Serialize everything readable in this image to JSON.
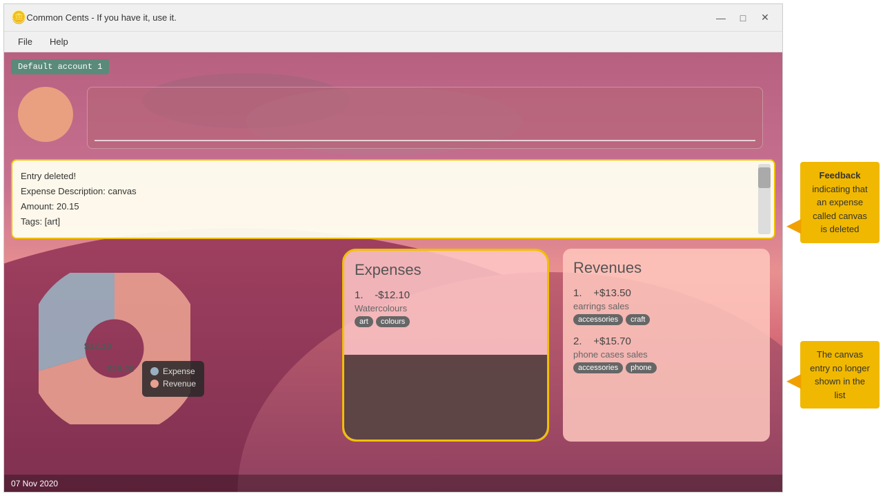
{
  "window": {
    "title": "Common Cents - If you have it, use it.",
    "controls": {
      "minimize": "—",
      "maximize": "□",
      "close": "✕"
    }
  },
  "menu": {
    "items": [
      "File",
      "Help"
    ]
  },
  "account": {
    "badge": "Default account 1"
  },
  "notification": {
    "line1": "Entry deleted!",
    "line2": "Expense Description: canvas",
    "line3": "Amount: 20.15",
    "line4": "Tags: [art]"
  },
  "chart": {
    "expense_label": "$12.10",
    "revenue_label": "$29.20",
    "legend": [
      {
        "label": "Expense",
        "color": "#9ab0c0"
      },
      {
        "label": "Revenue",
        "color": "#e8a090"
      }
    ]
  },
  "expenses": {
    "title": "Expenses",
    "items": [
      {
        "number": "1.",
        "amount": "-$12.10",
        "name": "Watercolours",
        "tags": [
          "art",
          "colours"
        ]
      }
    ]
  },
  "revenues": {
    "title": "Revenues",
    "items": [
      {
        "number": "1.",
        "amount": "+$13.50",
        "name": "earrings sales",
        "tags": [
          "accessories",
          "craft"
        ]
      },
      {
        "number": "2.",
        "amount": "+$15.70",
        "name": "phone cases sales",
        "tags": [
          "accessories",
          "phone"
        ]
      }
    ]
  },
  "annotations": {
    "feedback1": {
      "title": "Feedback",
      "text": "indicating that an expense called canvas is deleted"
    },
    "feedback2": {
      "text": "The canvas entry no longer shown in the list"
    }
  },
  "statusbar": {
    "date": "07 Nov 2020"
  }
}
